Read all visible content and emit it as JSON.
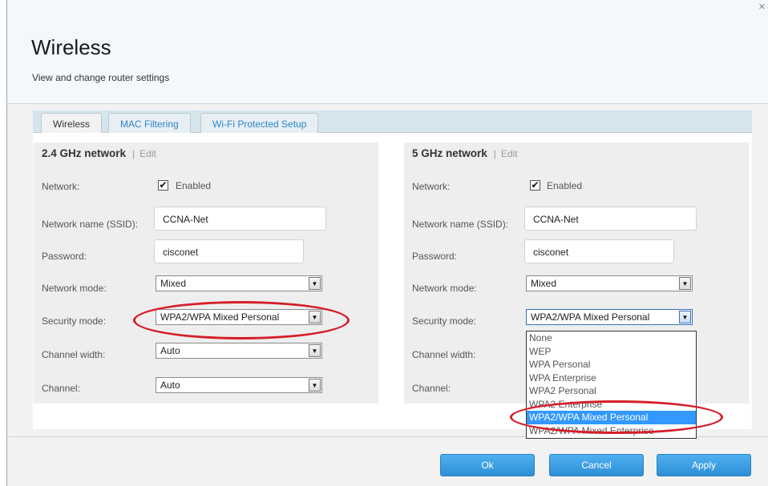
{
  "header": {
    "title": "Wireless",
    "subtitle": "View and change router settings"
  },
  "tabs": [
    {
      "label": "Wireless",
      "active": true
    },
    {
      "label": "MAC Filtering",
      "active": false
    },
    {
      "label": "Wi-Fi Protected Setup",
      "active": false
    }
  ],
  "networks": {
    "ghz24": {
      "title": "2.4 GHz network",
      "edit_label": "Edit",
      "network_label": "Network:",
      "enabled_label": "Enabled",
      "enabled_checked": "✔",
      "ssid_label": "Network name (SSID):",
      "ssid_value": "CCNA-Net",
      "password_label": "Password:",
      "password_value": "cisconet",
      "mode_label": "Network mode:",
      "mode_value": "Mixed",
      "security_label": "Security mode:",
      "security_value": "WPA2/WPA Mixed Personal",
      "width_label": "Channel width:",
      "width_value": "Auto",
      "channel_label": "Channel:",
      "channel_value": "Auto"
    },
    "ghz5": {
      "title": "5 GHz network",
      "edit_label": "Edit",
      "network_label": "Network:",
      "enabled_label": "Enabled",
      "enabled_checked": "✔",
      "ssid_label": "Network name (SSID):",
      "ssid_value": "CCNA-Net",
      "password_label": "Password:",
      "password_value": "cisconet",
      "mode_label": "Network mode:",
      "mode_value": "Mixed",
      "security_label": "Security mode:",
      "security_value": "WPA2/WPA Mixed Personal",
      "width_label": "Channel width:",
      "channel_label": "Channel:"
    }
  },
  "security_options": [
    "None",
    "WEP",
    "WPA Personal",
    "WPA Enterprise",
    "WPA2 Personal",
    "WPA2 Enterprise",
    "WPA2/WPA Mixed Personal",
    "WPA2/WPA Mixed Enterprise"
  ],
  "footer": {
    "ok_label": "Ok",
    "cancel_label": "Cancel",
    "apply_label": "Apply"
  },
  "colors": {
    "accent": "#2d8fd6",
    "tab_link": "#2f86c9",
    "highlight": "#3399ff",
    "annotation": "#d41f2a"
  },
  "icons": {
    "close": "close-icon",
    "dropdown": "chevron-down-icon",
    "checkbox": "checkmark-icon"
  }
}
